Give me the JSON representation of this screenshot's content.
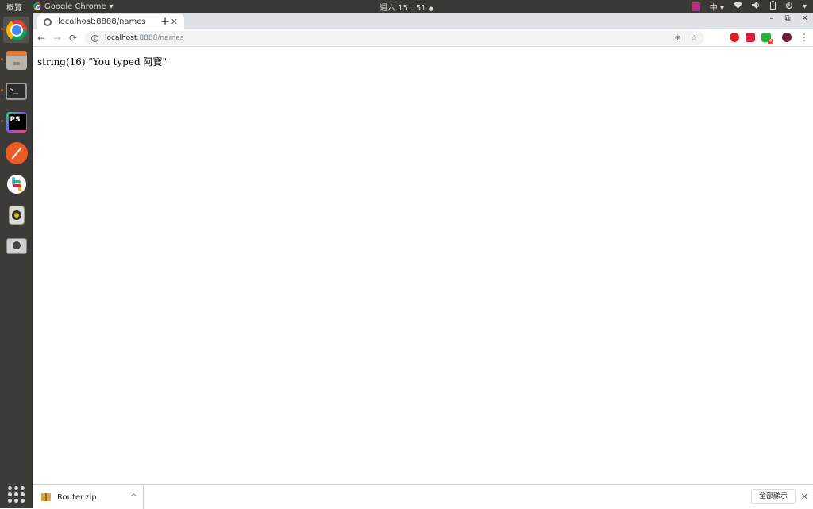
{
  "top_panel": {
    "activities": "概覽",
    "app_name": "Google Chrome",
    "app_arrow": "▾",
    "clock": "週六 15：51",
    "clock_dot": "●",
    "input_method": "中",
    "tray_arrow": "▾"
  },
  "dock": {
    "items": [
      "chrome",
      "files",
      "terminal",
      "phpstorm",
      "postman",
      "slack",
      "rhythmbox",
      "screenshot"
    ]
  },
  "browser": {
    "tab_title": "localhost:8888/names",
    "tab_close": "✕",
    "new_tab": "+",
    "window_controls": {
      "minimize": "–",
      "restore": "⧉",
      "close": "✕"
    },
    "nav": {
      "back": "←",
      "forward": "→",
      "reload": "⟳"
    },
    "url_host": "localhost",
    "url_path": ":8888/names",
    "zoom_icon": "⊕",
    "star_icon": "☆",
    "ext_badge": "4",
    "menu": "⋮"
  },
  "page": {
    "output": "string(16) \"You typed 阿寶\""
  },
  "downloads": {
    "file_name": "Router.zip",
    "chevron": "^",
    "show_all": "全部顯示",
    "close": "✕"
  },
  "colors": {
    "panel_bg": "#393834",
    "dock_bg": "#3c3b37",
    "tabbar_bg": "#dee1e6",
    "omnibox_bg": "#f1f3f4",
    "ubuntu_orange": "#e95420"
  }
}
